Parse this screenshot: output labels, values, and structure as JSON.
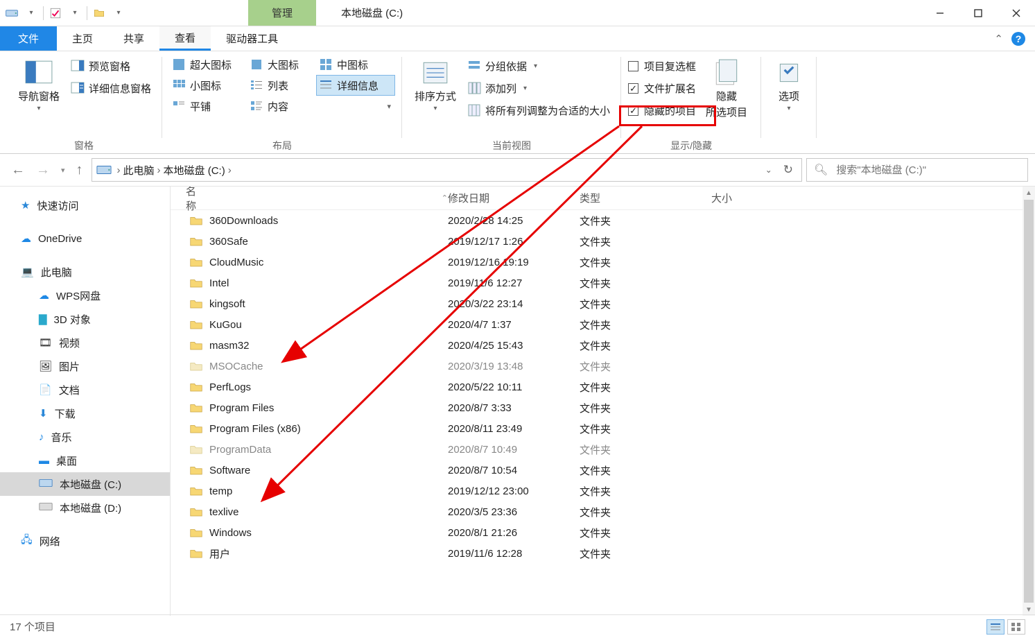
{
  "window": {
    "title": "本地磁盘 (C:)"
  },
  "tabs": {
    "file": "文件",
    "home": "主页",
    "share": "共享",
    "view": "查看",
    "manage": "管理",
    "tool": "驱动器工具"
  },
  "ribbon": {
    "panes": {
      "nav_button": "导航窗格",
      "preview_pane": "预览窗格",
      "details_pane": "详细信息窗格",
      "group_label": "窗格"
    },
    "layout": {
      "extra_large": "超大图标",
      "large": "大图标",
      "medium": "中图标",
      "small": "小图标",
      "list": "列表",
      "details": "详细信息",
      "tiles": "平铺",
      "content": "内容",
      "group_label": "布局"
    },
    "current_view": {
      "sort": "排序方式",
      "group_by": "分组依据",
      "add_cols": "添加列",
      "size_cols": "将所有列调整为合适的大小",
      "group_label": "当前视图"
    },
    "show_hide": {
      "item_checkboxes": "项目复选框",
      "file_ext": "文件扩展名",
      "hidden_items": "隐藏的项目",
      "hide_btn": "隐藏",
      "hide_btn2": "所选项目",
      "group_label": "显示/隐藏"
    },
    "options": "选项"
  },
  "breadcrumb": {
    "pc": "此电脑",
    "drive": "本地磁盘 (C:)"
  },
  "search": {
    "placeholder": "搜索\"本地磁盘 (C:)\""
  },
  "tree": {
    "quick": "快速访问",
    "onedrive": "OneDrive",
    "pc": "此电脑",
    "wps": "WPS网盘",
    "objects3d": "3D 对象",
    "videos": "视频",
    "pictures": "图片",
    "documents": "文档",
    "downloads": "下载",
    "music": "音乐",
    "desktop": "桌面",
    "drive_c": "本地磁盘 (C:)",
    "drive_d": "本地磁盘 (D:)",
    "network": "网络"
  },
  "columns": {
    "name": "名称",
    "date": "修改日期",
    "type": "类型",
    "size": "大小"
  },
  "rows": [
    {
      "name": "360Downloads",
      "date": "2020/2/28 14:25",
      "type": "文件夹",
      "hidden": false
    },
    {
      "name": "360Safe",
      "date": "2019/12/17 1:26",
      "type": "文件夹",
      "hidden": false
    },
    {
      "name": "CloudMusic",
      "date": "2019/12/16 19:19",
      "type": "文件夹",
      "hidden": false
    },
    {
      "name": "Intel",
      "date": "2019/11/6 12:27",
      "type": "文件夹",
      "hidden": false
    },
    {
      "name": "kingsoft",
      "date": "2020/3/22 23:14",
      "type": "文件夹",
      "hidden": false
    },
    {
      "name": "KuGou",
      "date": "2020/4/7 1:37",
      "type": "文件夹",
      "hidden": false
    },
    {
      "name": "masm32",
      "date": "2020/4/25 15:43",
      "type": "文件夹",
      "hidden": false
    },
    {
      "name": "MSOCache",
      "date": "2020/3/19 13:48",
      "type": "文件夹",
      "hidden": true
    },
    {
      "name": "PerfLogs",
      "date": "2020/5/22 10:11",
      "type": "文件夹",
      "hidden": false
    },
    {
      "name": "Program Files",
      "date": "2020/8/7 3:33",
      "type": "文件夹",
      "hidden": false
    },
    {
      "name": "Program Files (x86)",
      "date": "2020/8/11 23:49",
      "type": "文件夹",
      "hidden": false
    },
    {
      "name": "ProgramData",
      "date": "2020/8/7 10:49",
      "type": "文件夹",
      "hidden": true
    },
    {
      "name": "Software",
      "date": "2020/8/7 10:54",
      "type": "文件夹",
      "hidden": false
    },
    {
      "name": "temp",
      "date": "2019/12/12 23:00",
      "type": "文件夹",
      "hidden": false
    },
    {
      "name": "texlive",
      "date": "2020/3/5 23:36",
      "type": "文件夹",
      "hidden": false
    },
    {
      "name": "Windows",
      "date": "2020/8/1 21:26",
      "type": "文件夹",
      "hidden": false
    },
    {
      "name": "用户",
      "date": "2019/11/6 12:28",
      "type": "文件夹",
      "hidden": false
    }
  ],
  "status": {
    "count": "17 个项目"
  }
}
